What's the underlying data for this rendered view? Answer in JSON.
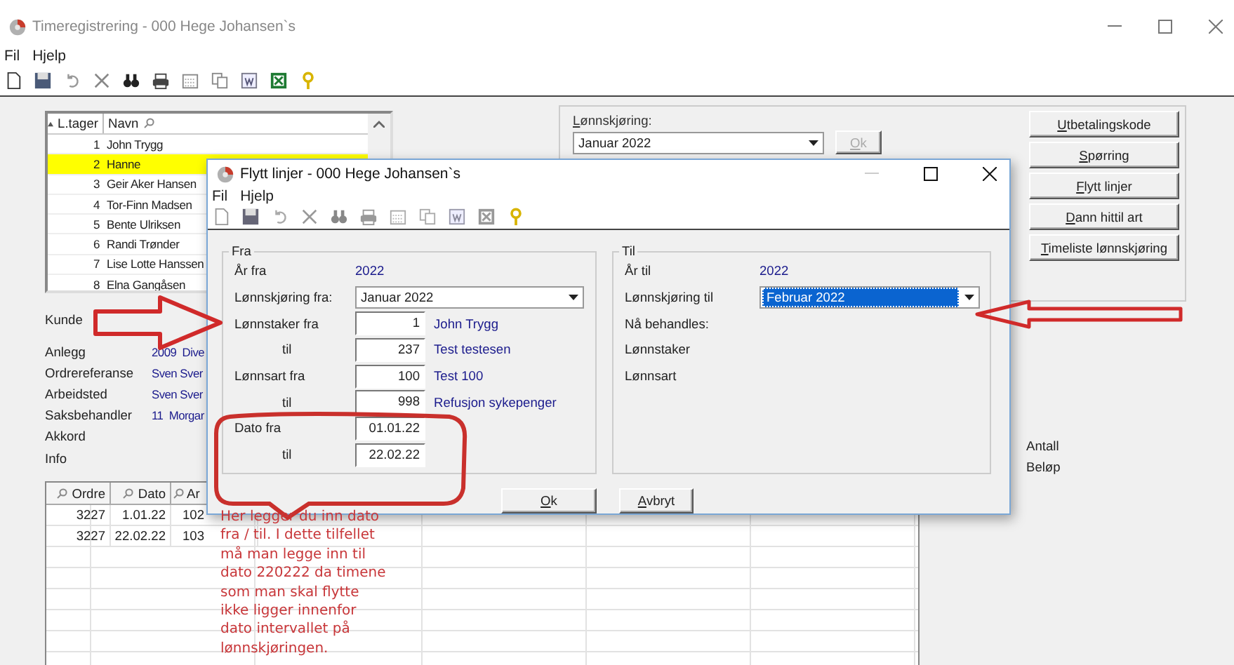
{
  "window": {
    "title": "Timeregistrering - 000 Hege Johansen`s"
  },
  "menu": [
    "Fil",
    "Hjelp"
  ],
  "employee_list": {
    "columns": [
      "L.tager",
      "Navn"
    ],
    "rows": [
      {
        "number": "1",
        "name": "John Trygg",
        "selected": false
      },
      {
        "number": "2",
        "name": "Hanne",
        "selected": true
      },
      {
        "number": "3",
        "name": "Geir Aker Hansen",
        "selected": false
      },
      {
        "number": "4",
        "name": "Tor-Finn Madsen",
        "selected": false
      },
      {
        "number": "5",
        "name": "Bente Ulriksen",
        "selected": false
      },
      {
        "number": "6",
        "name": "Randi Trønder",
        "selected": false
      },
      {
        "number": "7",
        "name": "Lise Lotte Hanssen",
        "selected": false
      },
      {
        "number": "8",
        "name": "Elna Gangåsen",
        "selected": false
      }
    ]
  },
  "customer_label": "Kunde",
  "fields": [
    {
      "label": "Anlegg",
      "value": "2009  Dive"
    },
    {
      "label": "Ordrereferanse",
      "value": "Sven Sver"
    },
    {
      "label": "Arbeidsted",
      "value": "Sven Sver"
    },
    {
      "label": "Saksbehandler",
      "value": "11  Morgar"
    },
    {
      "label": "Akkord"
    },
    {
      "label": "Info"
    }
  ],
  "orders": {
    "columns": [
      "Ordre",
      "Dato",
      "Ar"
    ],
    "rows": [
      [
        "3227",
        "1.01.22",
        "102"
      ],
      [
        "3227",
        "22.02.22",
        "103"
      ]
    ]
  },
  "payroll": {
    "label": "Lønnskjøring:",
    "value": "Januar 2022",
    "ok_button": {
      "label": "Ok",
      "disabled": true
    }
  },
  "actions": [
    "Utbetalingskode",
    "Spørring",
    "Flytt linjer",
    "Dann hittil art",
    "Timeliste lønnskjøring"
  ],
  "totals": [
    "Antall",
    "Beløp"
  ],
  "dialog": {
    "title": "Flytt linjer - 000 Hege Johansen`s",
    "menu": [
      "Fil",
      "Hjelp"
    ],
    "from": {
      "title": "Fra",
      "year_label": "År fra",
      "year": "2022",
      "payroll_label": "Lønnskjøring fra:",
      "payroll": "Januar 2022",
      "rows": [
        {
          "kind": "start",
          "label": "Lønnstaker fra",
          "value": "1",
          "name": "John Trygg"
        },
        {
          "kind": "end",
          "label": "til",
          "value": "237",
          "name": "Test testesen"
        },
        {
          "kind": "start",
          "label": "Lønnsart fra",
          "value": "100",
          "name": "Test 100"
        },
        {
          "kind": "end",
          "label": "til",
          "value": "998",
          "name": "Refusjon sykepenger"
        },
        {
          "kind": "start",
          "label": "Dato fra",
          "value": "01.01.22"
        },
        {
          "kind": "end",
          "label": "til",
          "value": "22.02.22"
        }
      ]
    },
    "to": {
      "title": "Til",
      "year_label": "År til",
      "year": "2022",
      "payroll_label": "Lønnskjøring til",
      "payroll": "Februar 2022",
      "payroll_focused": true,
      "labels": [
        "Nå behandles:",
        "Lønnstaker",
        "Lønnsart"
      ]
    },
    "buttons": [
      "Ok",
      "Avbryt"
    ]
  },
  "annotation": {
    "text": "Her legger du inn dato\nfra / til. I dette tilfellet\nmå man legge inn til\ndato 220222 da timene\nsom man skal flytte\nikke ligger innenfor\ndato intervallet på\nlønnskjøringen."
  }
}
